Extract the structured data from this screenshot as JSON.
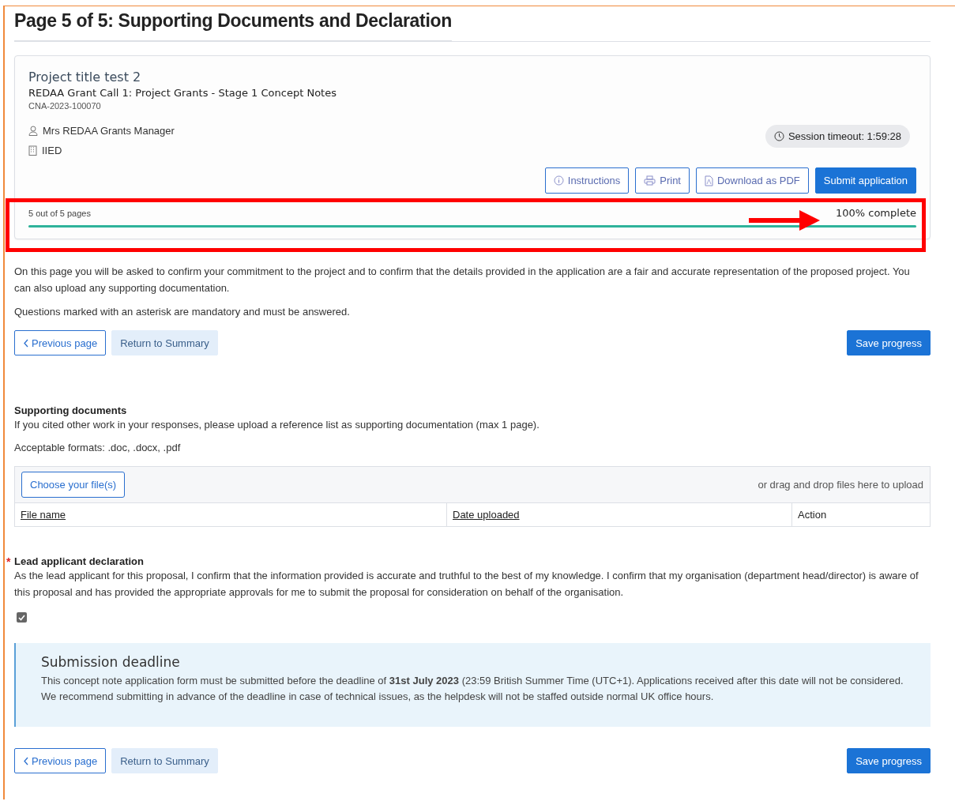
{
  "heading": "Page 5 of 5: Supporting Documents and Declaration",
  "project": {
    "title": "Project title test 2",
    "call": "REDAA Grant Call 1: Project Grants - Stage 1 Concept Notes",
    "reference": "CNA-2023-100070",
    "user": "Mrs REDAA Grants Manager",
    "organisation": "IIED",
    "session_timeout": "Session timeout: 1:59:28",
    "actions": [
      {
        "label": "Instructions",
        "kind": "info"
      },
      {
        "label": "Print",
        "kind": "print"
      },
      {
        "label": "Download as PDF",
        "kind": "pdf"
      },
      {
        "label": "Submit application",
        "kind": "primary"
      }
    ]
  },
  "progress": {
    "pages": "5 out of 5 pages",
    "reading": "100% complete",
    "level": 1
  },
  "intro": [
    "On this page you will be asked to confirm your commitment to the project and to confirm that the details provided in the application are a fair and accurate representation of the proposed project. You can also upload any supporting documentation.",
    "Questions marked with an asterisk are mandatory and must be answered."
  ],
  "nav_top": {
    "previous": "Previous page",
    "summary": "Return to Summary",
    "save": "Save progress"
  },
  "supporting": {
    "title": "Supporting documents",
    "description": "If you cited other work in your responses, please upload a reference list as supporting documentation (max 1 page).",
    "formats": "Acceptable formats: .doc, .docx, .pdf",
    "choose_button": "Choose your file(s)",
    "drop_hint": "or drag and drop files here to upload",
    "columns": [
      {
        "label": "File name",
        "sortable": true
      },
      {
        "label": "Date uploaded",
        "sortable": true
      },
      {
        "label": "Action",
        "sortable": false
      }
    ]
  },
  "declaration": {
    "marker": "*",
    "title": "Lead applicant declaration",
    "text": "As the lead applicant for this proposal, I confirm that the information provided is accurate and truthful to the best of my knowledge. I confirm that my organisation (department head/director) is aware of this proposal and has provided the appropriate approvals for me to submit the proposal for consideration on behalf of the organisation.",
    "checked": true
  },
  "deadline": {
    "title": "Submission deadline",
    "text": "This concept note application form must be submitted before the deadline of **31st July 2023** (23:59 British Summer Time (UTC+1). Applications received after this date will not be considered. We recommend submitting in advance of the deadline in case of technical issues, as the helpdesk will not be staffed outside normal UK office hours."
  },
  "nav_bottom": {
    "previous": "Previous page",
    "summary": "Return to Summary",
    "save": "Save progress"
  }
}
